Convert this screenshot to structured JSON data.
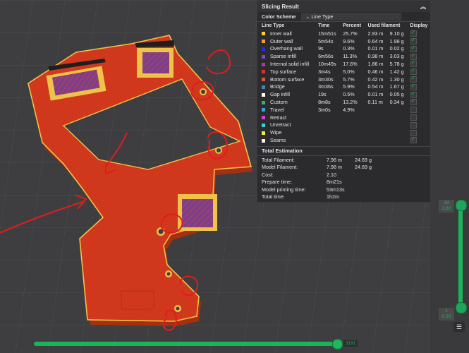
{
  "panel": {
    "title": "Slicing Result",
    "collapse_icon": "double-chevron-up-icon",
    "color_scheme_label": "Color Scheme",
    "color_scheme_value": "Line Type",
    "headers": [
      "Line Type",
      "Time",
      "Percent",
      "Used filament",
      "Display"
    ],
    "rows": [
      {
        "name": "Inner wall",
        "time": "15m51s",
        "percent": "25.7%",
        "len": "2.93 m",
        "wt": "9.10 g",
        "color": "#f7d23a",
        "display": true
      },
      {
        "name": "Outer wall",
        "time": "5m54s",
        "percent": "9.6%",
        "len": "0.64 m",
        "wt": "1.98 g",
        "color": "#f39c3b",
        "display": true
      },
      {
        "name": "Overhang wall",
        "time": "9s",
        "percent": "0.3%",
        "len": "0.01 m",
        "wt": "0.02 g",
        "color": "#2a2ae0",
        "display": true
      },
      {
        "name": "Sparse infill",
        "time": "6m56s",
        "percent": "11.3%",
        "len": "0.98 m",
        "wt": "3.03 g",
        "color": "#7a4db8",
        "display": true
      },
      {
        "name": "Internal solid infill",
        "time": "10m49s",
        "percent": "17.6%",
        "len": "1.86 m",
        "wt": "5.78 g",
        "color": "#a03ea6",
        "display": true
      },
      {
        "name": "Top surface",
        "time": "3m4s",
        "percent": "5.0%",
        "len": "0.46 m",
        "wt": "1.42 g",
        "color": "#e0302c",
        "display": true
      },
      {
        "name": "Bottom surface",
        "time": "3m30s",
        "percent": "5.7%",
        "len": "0.42 m",
        "wt": "1.30 g",
        "color": "#d65a4a",
        "display": true
      },
      {
        "name": "Bridge",
        "time": "3m36s",
        "percent": "5.9%",
        "len": "0.54 m",
        "wt": "1.67 g",
        "color": "#4f7fb8",
        "display": true
      },
      {
        "name": "Gap infill",
        "time": "19s",
        "percent": "0.5%",
        "len": "0.01 m",
        "wt": "0.05 g",
        "color": "#ffffff",
        "display": true
      },
      {
        "name": "Custom",
        "time": "8m8s",
        "percent": "13.2%",
        "len": "0.11 m",
        "wt": "0.34 g",
        "color": "#2fb36e",
        "display": true
      },
      {
        "name": "Travel",
        "time": "3m0s",
        "percent": "4.9%",
        "len": "",
        "wt": "",
        "color": "#3aa0d8",
        "display": false
      },
      {
        "name": "Retract",
        "time": "",
        "percent": "",
        "len": "",
        "wt": "",
        "color": "#d63fd6",
        "display": false
      },
      {
        "name": "Unretract",
        "time": "",
        "percent": "",
        "len": "",
        "wt": "",
        "color": "#3fd0d6",
        "display": false
      },
      {
        "name": "Wipe",
        "time": "",
        "percent": "",
        "len": "",
        "wt": "",
        "color": "#ece94a",
        "display": false
      },
      {
        "name": "Seams",
        "time": "",
        "percent": "",
        "len": "",
        "wt": "",
        "color": "#f2f2f2",
        "display": true
      }
    ],
    "total_title": "Total Estimation",
    "totals": [
      {
        "k": "Total Filament:",
        "v1": "7.96 m",
        "v2": "24.69 g"
      },
      {
        "k": "Model Filament:",
        "v1": "7.96 m",
        "v2": "24.69 g"
      },
      {
        "k": "Cost:",
        "v1": "2.10",
        "v2": ""
      },
      {
        "k": "Prepare time:",
        "v1": "8m21s",
        "v2": ""
      },
      {
        "k": "Model printing time:",
        "v1": "53m13s",
        "v2": ""
      },
      {
        "k": "Total time:",
        "v1": "1h2m",
        "v2": ""
      }
    ]
  },
  "layer_top": {
    "layer": "18",
    "height": "3.60"
  },
  "layer_bottom": {
    "layer": "1",
    "height": "0.20"
  },
  "move_value": "3191",
  "layers_icon": "layers-icon",
  "colors": {
    "slider": "#19b558",
    "part": "#d8391f",
    "wall": "#e7c24a"
  }
}
